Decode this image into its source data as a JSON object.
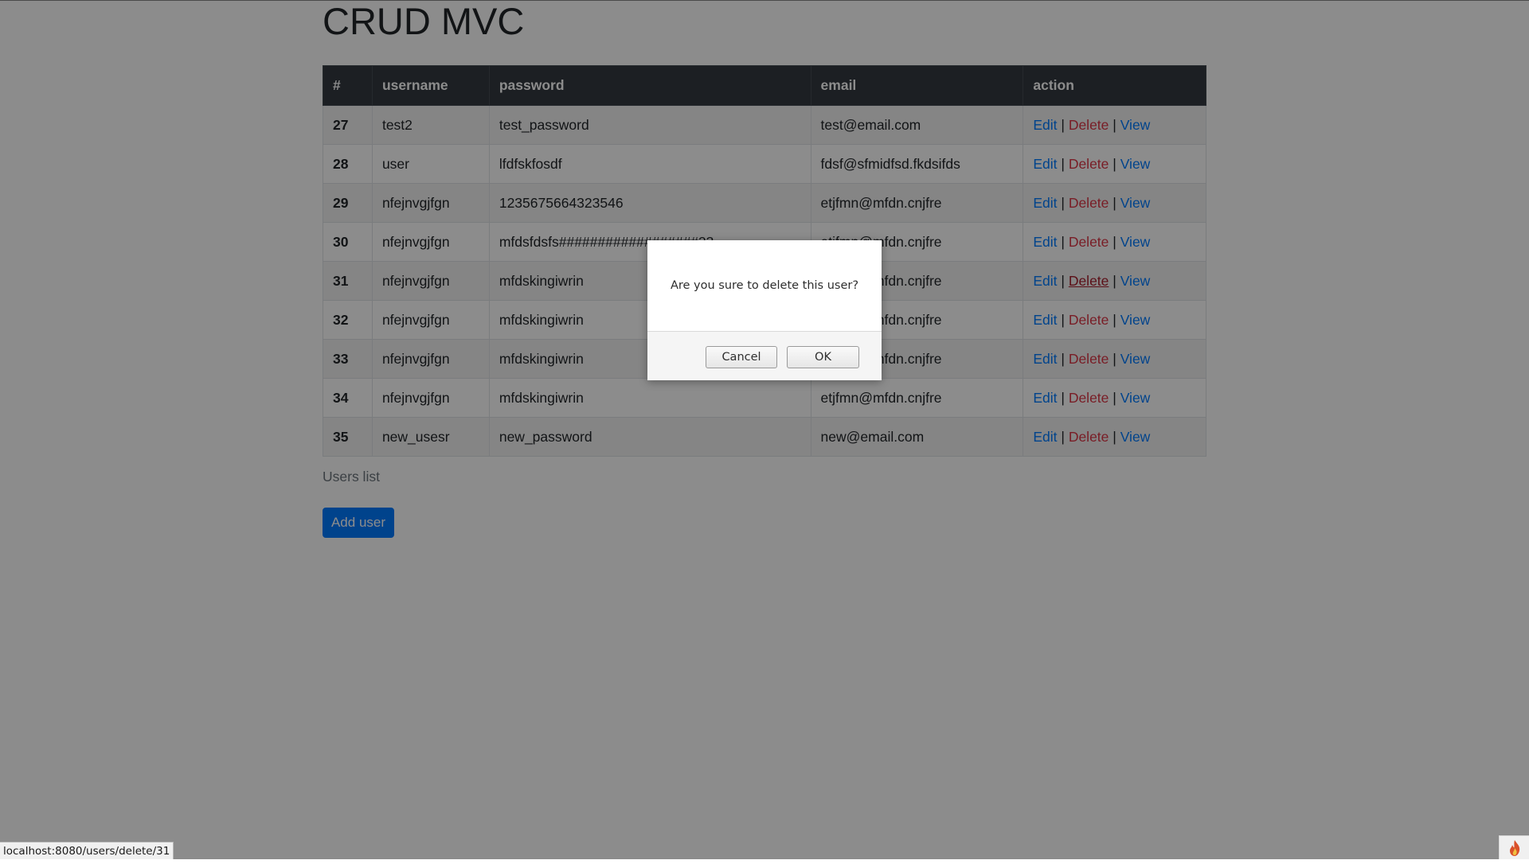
{
  "page": {
    "title": "CRUD MVC",
    "caption": "Users list",
    "add_button": "Add user"
  },
  "table": {
    "headers": [
      "#",
      "username",
      "password",
      "email",
      "action"
    ],
    "rows": [
      {
        "id": "27",
        "username": "test2",
        "password": "test_password",
        "email": "test@email.com"
      },
      {
        "id": "28",
        "username": "user",
        "password": "lfdfskfosdf",
        "email": "fdsf@sfmidfsd.fkdsifds"
      },
      {
        "id": "29",
        "username": "nfejnvgjfgn",
        "password": "1235675664323546",
        "email": "etjfmn@mfdn.cnjfre"
      },
      {
        "id": "30",
        "username": "nfejnvgjfgn",
        "password": "mfdsfdsfs##################23",
        "email": "etjfmn@mfdn.cnjfre"
      },
      {
        "id": "31",
        "username": "nfejnvgjfgn",
        "password": "mfdskingiwrin",
        "email": "etjfmn@mfdn.cnjfre"
      },
      {
        "id": "32",
        "username": "nfejnvgjfgn",
        "password": "mfdskingiwrin",
        "email": "etjfmn@mfdn.cnjfre"
      },
      {
        "id": "33",
        "username": "nfejnvgjfgn",
        "password": "mfdskingiwrin",
        "email": "etjfmn@mfdn.cnjfre"
      },
      {
        "id": "34",
        "username": "nfejnvgjfgn",
        "password": "mfdskingiwrin",
        "email": "etjfmn@mfdn.cnjfre"
      },
      {
        "id": "35",
        "username": "new_usesr",
        "password": "new_password",
        "email": "new@email.com"
      }
    ],
    "actions": {
      "edit": "Edit",
      "delete": "Delete",
      "view": "View",
      "separator": "|"
    },
    "hovered_row_id": "31"
  },
  "dialog": {
    "message": "Are you sure to delete this user?",
    "cancel_label": "Cancel",
    "ok_label": "OK"
  },
  "statusbar": {
    "url": "localhost:8080/users/delete/31"
  },
  "icons": {
    "corner": "flame-icon"
  },
  "colors": {
    "link": "#007bff",
    "delete": "#dc3545",
    "header_bg": "#343a40",
    "button": "#007bff"
  }
}
